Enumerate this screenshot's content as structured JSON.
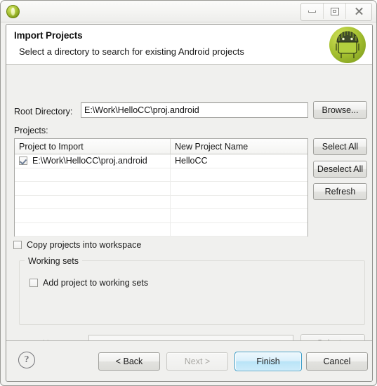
{
  "window": {
    "icon": "eclipse-app-icon",
    "controls": [
      {
        "name": "minimize",
        "label": "–"
      },
      {
        "name": "restore",
        "label": "□"
      },
      {
        "name": "close",
        "label": "✕"
      }
    ]
  },
  "header": {
    "title": "Import Projects",
    "subtitle": "Select a directory to search for existing Android projects",
    "logo": "android-robot-icon"
  },
  "form": {
    "root_directory_label": "Root Directory:",
    "root_directory_value": "E:\\Work\\HelloCC\\proj.android",
    "root_directory_placeholder": "",
    "browse_label": "Browse...",
    "projects_label": "Projects:"
  },
  "table": {
    "columns": [
      "Project to Import",
      "New Project Name"
    ],
    "rows": [
      {
        "checked": true,
        "project_to_import": "E:\\Work\\HelloCC\\proj.android",
        "new_project_name": "HelloCC"
      },
      {
        "checked": null,
        "project_to_import": "",
        "new_project_name": ""
      },
      {
        "checked": null,
        "project_to_import": "",
        "new_project_name": ""
      },
      {
        "checked": null,
        "project_to_import": "",
        "new_project_name": ""
      },
      {
        "checked": null,
        "project_to_import": "",
        "new_project_name": ""
      },
      {
        "checked": null,
        "project_to_import": "",
        "new_project_name": ""
      }
    ],
    "buttons": {
      "select_all": "Select All",
      "deselect_all": "Deselect All",
      "refresh": "Refresh"
    }
  },
  "options": {
    "copy_projects_label": "Copy projects into workspace",
    "copy_projects_checked": false,
    "working_sets_group_title": "Working sets",
    "add_project_label": "Add project to working sets",
    "add_project_checked": false,
    "working_sets_label": "Working sets:",
    "working_sets_value": "",
    "select_label": "Select..."
  },
  "footer": {
    "help_label": "?",
    "back_label": "< Back",
    "next_label": "Next >",
    "finish_label": "Finish",
    "cancel_label": "Cancel"
  },
  "colors": {
    "dialog_background": "#f0f0ee",
    "header_background": "#ffffff",
    "accent_focus_border": "#3d9ec9",
    "finish_button_fill": "#cdecfa",
    "android_green": "#a4bf2f",
    "disabled_text": "#a9a9a5"
  }
}
